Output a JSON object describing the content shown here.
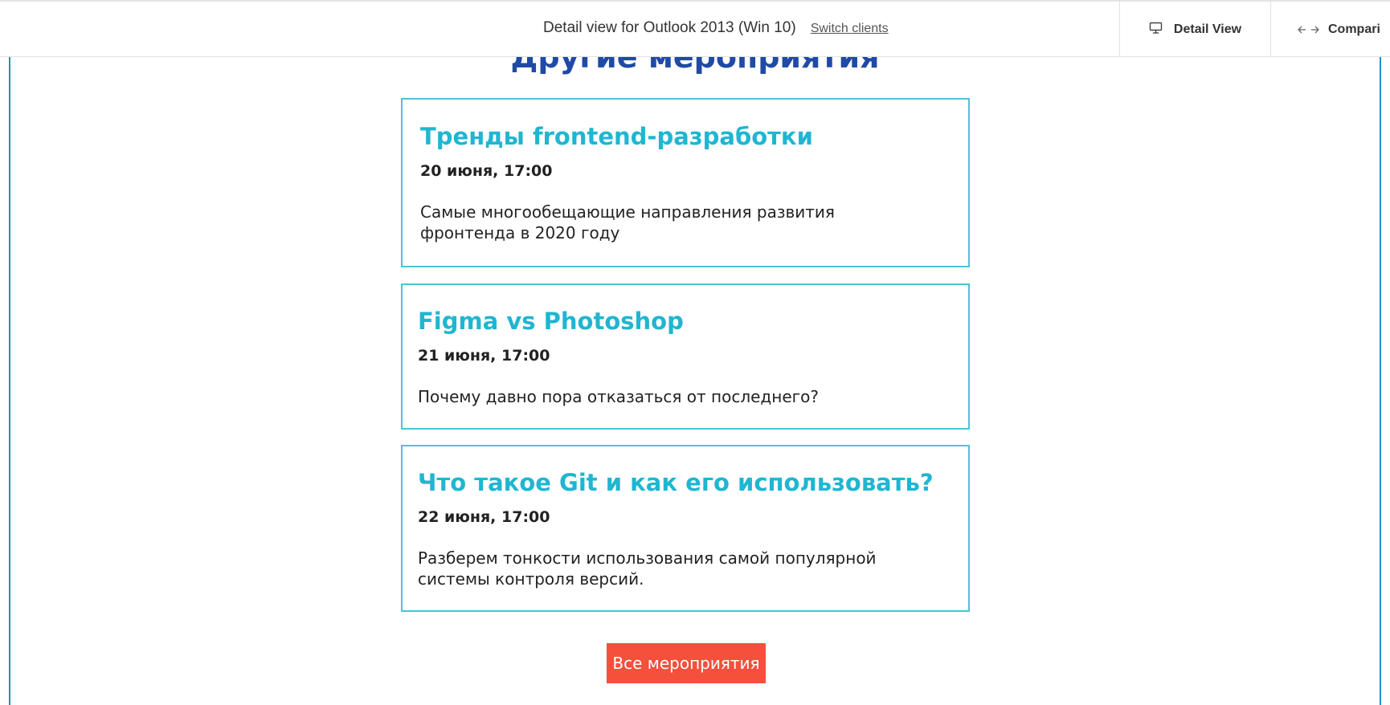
{
  "toolbar": {
    "client_title": "Detail view for Outlook 2013 (Win 10)",
    "switch_clients": "Switch clients",
    "detail_view": "Detail View",
    "compare": "Compari",
    "detail_view_icon": "monitor-icon",
    "compare_icon": "arrows-left-right-icon"
  },
  "email": {
    "section_heading": "Другие мероприятия",
    "events": [
      {
        "title": "Тренды frontend-разработки",
        "date": "20 июня, 17:00",
        "description": "Самые многообещающие направления развития фронтенда в 2020 году"
      },
      {
        "title": "Figma vs Photoshop",
        "date": "21 июня, 17:00",
        "description": "Почему давно пора отказаться от последнего?"
      },
      {
        "title": "Что такое Git и как его использовать?",
        "date": "22 июня, 17:00",
        "description": "Разберем тонкости использования самой популярной системы контроля версий."
      }
    ],
    "all_events_button": "Все мероприятия"
  },
  "colors": {
    "heading": "#1f4aa6",
    "event_title": "#1fb6d1",
    "card_border": "#4dc3d8",
    "button_bg": "#f4503c",
    "frame_border": "#2a8fbf"
  }
}
